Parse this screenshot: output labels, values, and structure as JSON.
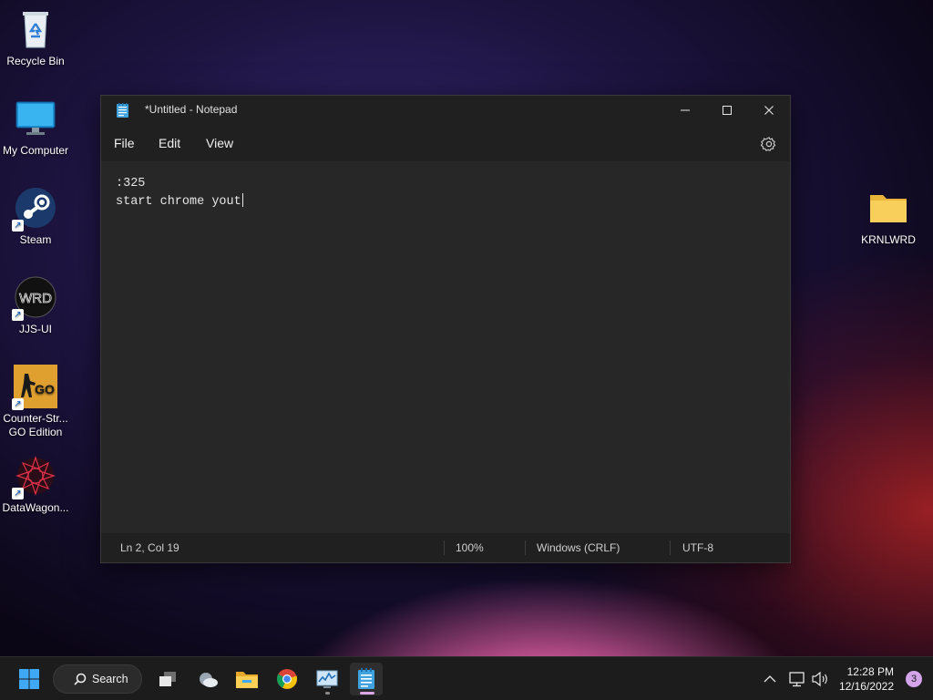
{
  "desktop": {
    "icons": [
      {
        "label": "Recycle Bin"
      },
      {
        "label": "My Computer"
      },
      {
        "label": "Steam"
      },
      {
        "label": "JJS-UI",
        "art_text": "WRD"
      },
      {
        "label_line1": "Counter-Str...",
        "label_line2": "GO Edition",
        "art_text": "GO"
      },
      {
        "label": "DataWagon..."
      },
      {
        "label": "KRNLWRD"
      }
    ]
  },
  "notepad": {
    "title": "*Untitled - Notepad",
    "menu": [
      "File",
      "Edit",
      "View"
    ],
    "content_lines": [
      ":325",
      "start chrome yout"
    ],
    "status": {
      "position": "Ln 2, Col 19",
      "zoom": "100%",
      "line_ending": "Windows (CRLF)",
      "encoding": "UTF-8"
    },
    "icons": {
      "app": "notepad-icon",
      "minimize": "minimize-icon",
      "maximize": "maximize-icon",
      "close": "close-icon",
      "settings": "gear-icon"
    }
  },
  "taskbar": {
    "search_label": "Search",
    "time": "12:28 PM",
    "date": "12/16/2022",
    "notification_count": "3",
    "apps": [
      "start-icon",
      "task-view-icon",
      "weather-icon",
      "file-explorer-icon",
      "chrome-icon",
      "task-manager-icon",
      "notepad-icon"
    ]
  },
  "colors": {
    "window_bg": "#202020",
    "editor_bg": "#272727",
    "taskbar_bg": "#1c1c1c",
    "accent": "#d9a6e8"
  }
}
